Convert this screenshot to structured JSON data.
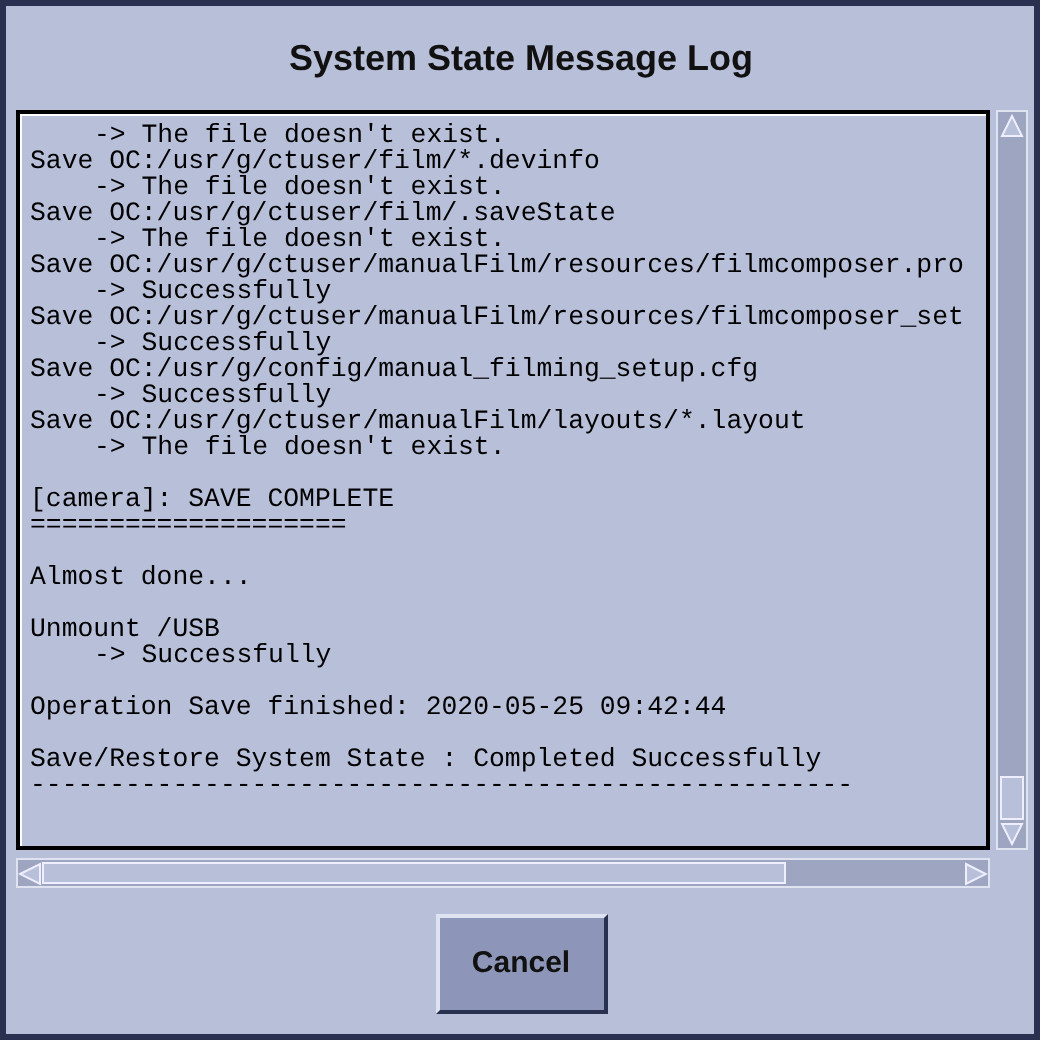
{
  "window": {
    "title": "System State Message Log"
  },
  "log": [
    {
      "kind": "result",
      "text": "-> The file doesn't exist."
    },
    {
      "kind": "line",
      "text": "Save OC:/usr/g/ctuser/film/*.devinfo"
    },
    {
      "kind": "result",
      "text": "-> The file doesn't exist."
    },
    {
      "kind": "line",
      "text": "Save OC:/usr/g/ctuser/film/.saveState"
    },
    {
      "kind": "result",
      "text": "-> The file doesn't exist."
    },
    {
      "kind": "line",
      "text": "Save OC:/usr/g/ctuser/manualFilm/resources/filmcomposer.pro"
    },
    {
      "kind": "result",
      "text": "-> Successfully"
    },
    {
      "kind": "line",
      "text": "Save OC:/usr/g/ctuser/manualFilm/resources/filmcomposer_set"
    },
    {
      "kind": "result",
      "text": "-> Successfully"
    },
    {
      "kind": "line",
      "text": "Save OC:/usr/g/config/manual_filming_setup.cfg"
    },
    {
      "kind": "result",
      "text": "-> Successfully"
    },
    {
      "kind": "line",
      "text": "Save OC:/usr/g/ctuser/manualFilm/layouts/*.layout"
    },
    {
      "kind": "result",
      "text": "-> The file doesn't exist."
    },
    {
      "kind": "gap"
    },
    {
      "kind": "line",
      "text": "[camera]: SAVE COMPLETE"
    },
    {
      "kind": "line",
      "text": "===================="
    },
    {
      "kind": "gap"
    },
    {
      "kind": "line",
      "text": "Almost done..."
    },
    {
      "kind": "gap"
    },
    {
      "kind": "line",
      "text": "Unmount /USB"
    },
    {
      "kind": "result",
      "text": "-> Successfully"
    },
    {
      "kind": "gap"
    },
    {
      "kind": "line",
      "text": "Operation Save finished: 2020-05-25 09:42:44"
    },
    {
      "kind": "gap"
    },
    {
      "kind": "line",
      "text": "Save/Restore System State : Completed Successfully"
    },
    {
      "kind": "line",
      "text": "----------------------------------------------------"
    }
  ],
  "buttons": [
    {
      "label": "Cancel"
    }
  ]
}
